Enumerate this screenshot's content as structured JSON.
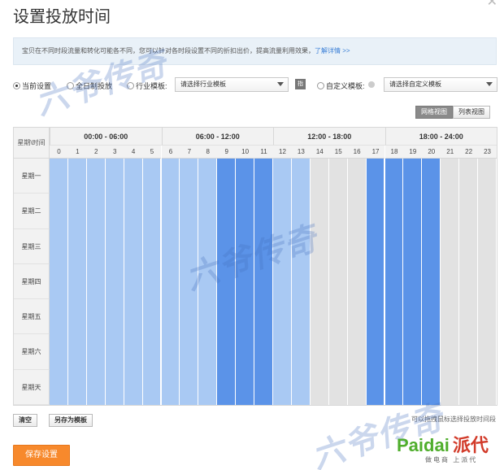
{
  "title": "设置投放时间",
  "notice": {
    "text": "宝贝在不同时段流量和转化可能各不同，您可以针对各时段设置不同的折扣出价，提高流量利用效果，",
    "link": "了解详情 >>"
  },
  "options": {
    "current": "当前设置",
    "all_day": "全日制投放",
    "industry": "行业模板:",
    "industry_select": "请选择行业模板",
    "custom": "自定义模板:",
    "custom_select": "请选择自定义模板"
  },
  "views": {
    "grid": "网格视图",
    "list": "列表视图"
  },
  "grid": {
    "corner": "星期\\时间",
    "groups": [
      "00:00 - 06:00",
      "06:00 - 12:00",
      "12:00 - 18:00",
      "18:00 - 24:00"
    ],
    "hours": [
      "0",
      "1",
      "2",
      "3",
      "4",
      "5",
      "6",
      "7",
      "8",
      "9",
      "10",
      "11",
      "12",
      "13",
      "14",
      "15",
      "16",
      "17",
      "18",
      "19",
      "20",
      "21",
      "22",
      "23"
    ],
    "days": [
      "星期一",
      "星期二",
      "星期三",
      "星期四",
      "星期五",
      "星期六",
      "星期天"
    ],
    "hour_levels": [
      "light",
      "light",
      "light",
      "light",
      "light",
      "light",
      "light",
      "light",
      "light",
      "dark",
      "dark",
      "dark",
      "light",
      "light",
      "none",
      "none",
      "none",
      "dark",
      "dark",
      "dark",
      "dark",
      "none",
      "none",
      "none"
    ],
    "colors": {
      "light": "#a9c9f3",
      "dark": "#5b93e8",
      "none": "#e2e2e2"
    }
  },
  "actions": {
    "clear": "清空",
    "save_template": "另存为模板",
    "hint": "可以拖拽鼠标选择投放时间段"
  },
  "save": "保存设置",
  "watermark": "六爷传奇",
  "brand": {
    "name": "Paidai",
    "cn": "派代",
    "slogan": "做电商 上派代"
  }
}
